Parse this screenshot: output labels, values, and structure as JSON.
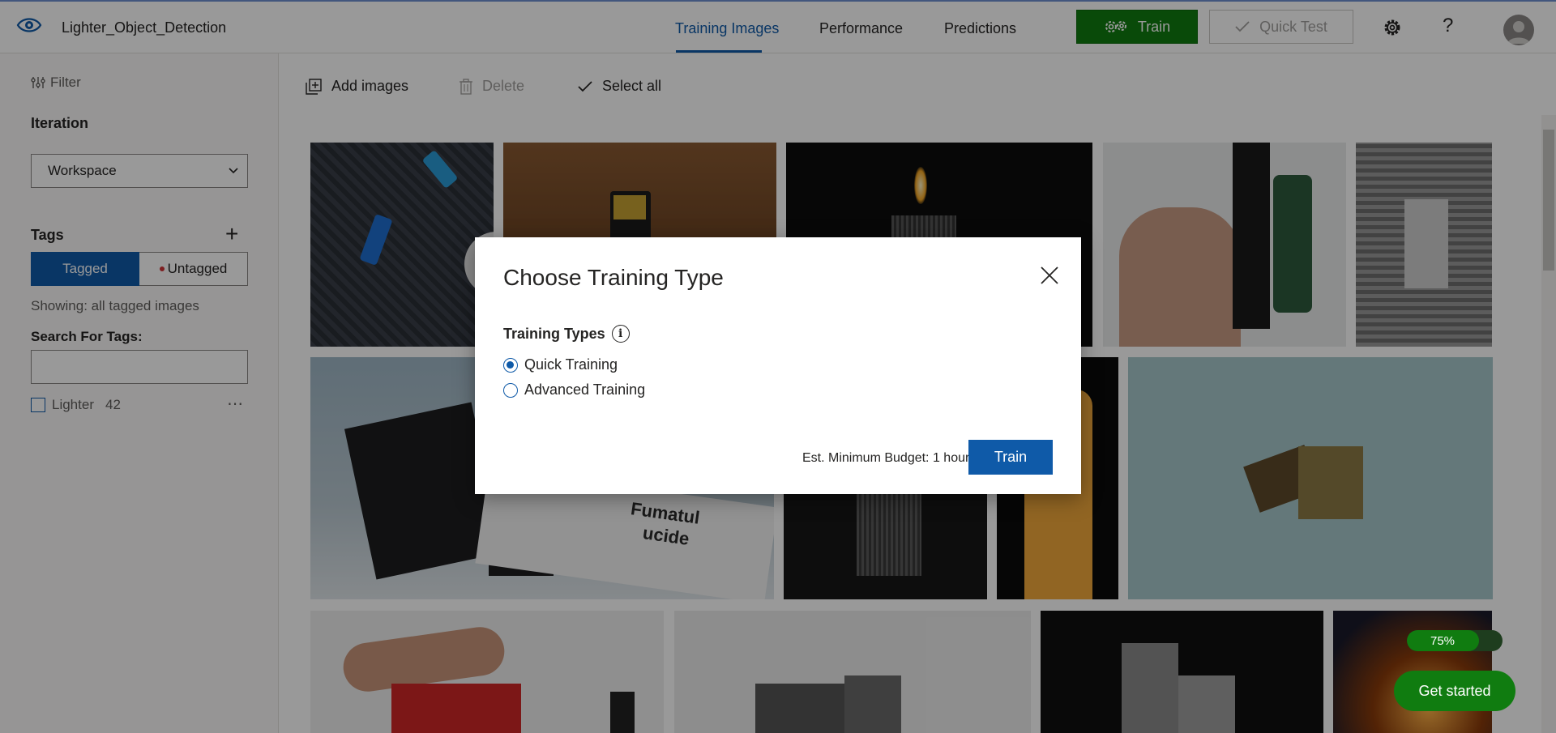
{
  "header": {
    "project_name": "Lighter_Object_Detection",
    "tabs": [
      {
        "label": "Training Images"
      },
      {
        "label": "Performance"
      },
      {
        "label": "Predictions"
      }
    ],
    "train_label": "Train",
    "quick_test_label": "Quick Test",
    "help_label": "?"
  },
  "sidebar": {
    "filter_label": "Filter",
    "iteration_label": "Iteration",
    "iteration_value": "Workspace",
    "tags_label": "Tags",
    "tagged_label": "Tagged",
    "untagged_label": "Untagged",
    "showing_text": "Showing: all tagged images",
    "search_label": "Search For Tags:",
    "tags": [
      {
        "name": "Lighter",
        "count": "42"
      }
    ]
  },
  "toolbar": {
    "add_images_label": "Add images",
    "delete_label": "Delete",
    "select_all_label": "Select all"
  },
  "images": {
    "visible_text": [
      "Fumatul",
      "ucide"
    ]
  },
  "dialog": {
    "title": "Choose Training Type",
    "types_label": "Training Types",
    "info_glyph": "i",
    "options": [
      {
        "label": "Quick Training",
        "selected": true
      },
      {
        "label": "Advanced Training",
        "selected": false
      }
    ],
    "budget_text": "Est. Minimum Budget: 1 hour",
    "train_label": "Train"
  },
  "widgets": {
    "progress_label": "75%",
    "progress_value": 0.75,
    "get_started_label": "Get started"
  },
  "colors": {
    "accent_blue": "#0f5aa8",
    "train_green": "#107c10"
  }
}
